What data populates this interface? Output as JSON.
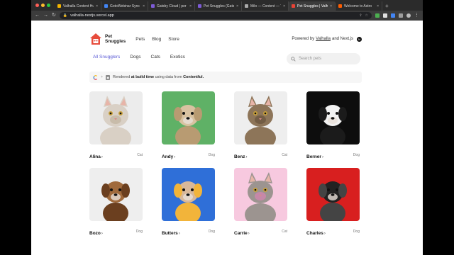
{
  "browser": {
    "tabs": [
      {
        "label": "Valhalla Content Hub",
        "color": "#f4b400",
        "active": false
      },
      {
        "label": "GotoWebinar Sync a",
        "color": "#4285f4",
        "active": false
      },
      {
        "label": "Gatsby Cloud | per",
        "color": "#7d5bd6",
        "active": false
      },
      {
        "label": "Pet Snuggles (Gatsb",
        "color": "#7d5bd6",
        "active": false
      },
      {
        "label": "Milo — Content — T",
        "color": "#aaaaaa",
        "active": false
      },
      {
        "label": "Pet Snuggles | Valh",
        "color": "#ea4335",
        "active": true
      },
      {
        "label": "Welcome to Astro",
        "color": "#ff5d01",
        "active": false
      }
    ],
    "url": "valhalla-nextjs.vercel.app"
  },
  "site": {
    "logo_line1": "Pet",
    "logo_line2": "Snuggles",
    "nav": [
      "Pets",
      "Blog",
      "Store"
    ],
    "powered_prefix": "Powered by",
    "powered_link": "Valhalla",
    "powered_suffix": "and Next.js",
    "filters": [
      "All Snugglers",
      "Dogs",
      "Cats",
      "Exotics"
    ],
    "search_placeholder": "Search pets",
    "info": {
      "prefix": "Rendered",
      "bold1": "at build time",
      "middle": "using data from",
      "bold2": "Contentful."
    }
  },
  "pets": [
    {
      "name": "Alina",
      "type": "Cat",
      "bg": "#ececec",
      "animal": "cat",
      "fur": "#d9d0c5",
      "accent": "#b8a78f"
    },
    {
      "name": "Andy",
      "type": "Dog",
      "bg": "#5fb166",
      "animal": "dog",
      "fur": "#d8c2a1",
      "accent": "#b89b72"
    },
    {
      "name": "Benz",
      "type": "Cat",
      "bg": "#eeeeee",
      "animal": "cat",
      "fur": "#8d7559",
      "accent": "#5a4632"
    },
    {
      "name": "Berner",
      "type": "Dog",
      "bg": "#0d0d0d",
      "animal": "dog",
      "fur": "#f2f2f2",
      "accent": "#1b1b1b"
    },
    {
      "name": "Bozo",
      "type": "Dog",
      "bg": "#eeeeee",
      "animal": "dog",
      "fur": "#a06a3c",
      "accent": "#6b3f1f"
    },
    {
      "name": "Butters",
      "type": "Dog",
      "bg": "#2f6fd8",
      "animal": "dog",
      "fur": "#d8b89a",
      "accent": "#f2b43a"
    },
    {
      "name": "Carrie",
      "type": "Cat",
      "bg": "#f7c9df",
      "animal": "cat",
      "fur": "#9c9490",
      "accent": "#f07cc0"
    },
    {
      "name": "Charles",
      "type": "Dog",
      "bg": "#d81f1f",
      "animal": "dog",
      "fur": "#222222",
      "accent": "#444444"
    }
  ]
}
